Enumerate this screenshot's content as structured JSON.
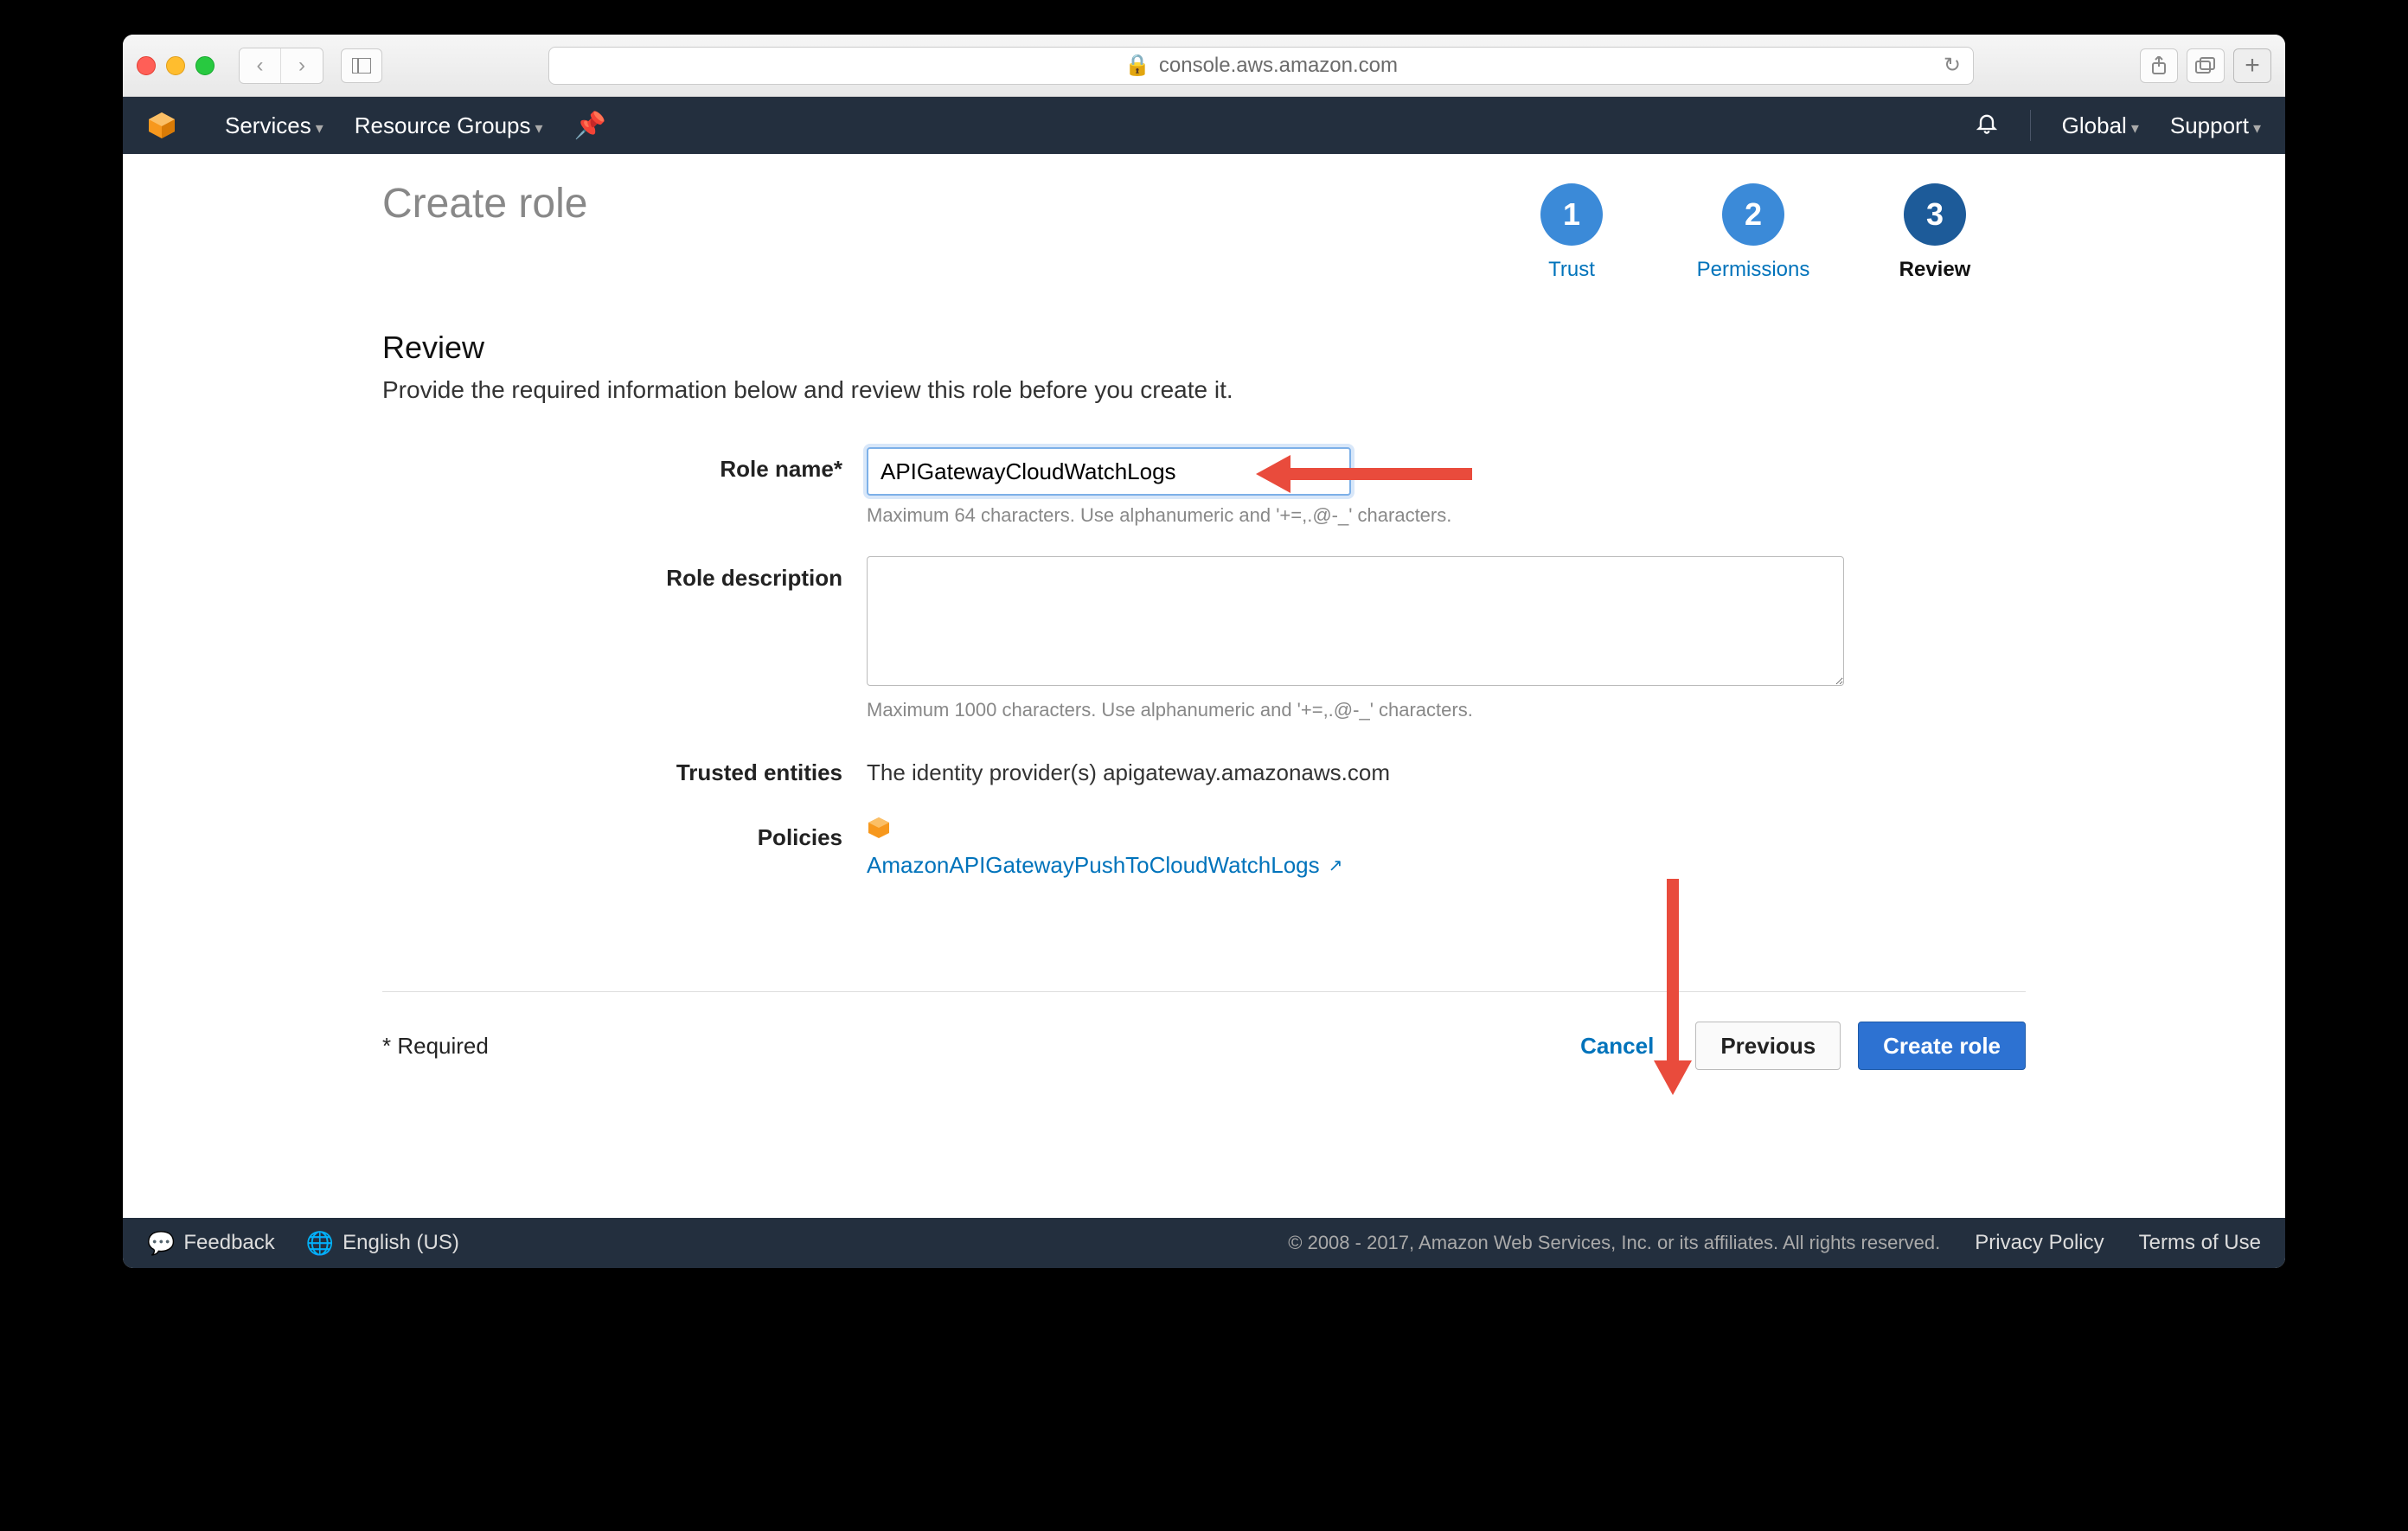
{
  "browser": {
    "url_host": "console.aws.amazon.com",
    "lock": "🔒"
  },
  "nav": {
    "services": "Services",
    "resource_groups": "Resource Groups",
    "global": "Global",
    "support": "Support"
  },
  "title": "Create role",
  "steps": [
    {
      "num": "1",
      "label": "Trust"
    },
    {
      "num": "2",
      "label": "Permissions"
    },
    {
      "num": "3",
      "label": "Review"
    }
  ],
  "section": {
    "heading": "Review",
    "desc": "Provide the required information below and review this role before you create it."
  },
  "form": {
    "role_name_label": "Role name*",
    "role_name_value": "APIGatewayCloudWatchLogs",
    "role_name_hint": "Maximum 64 characters. Use alphanumeric and '+=,.@-_' characters.",
    "role_desc_label": "Role description",
    "role_desc_value": "",
    "role_desc_hint": "Maximum 1000 characters. Use alphanumeric and '+=,.@-_' characters.",
    "trusted_label": "Trusted entities",
    "trusted_value": "The identity provider(s) apigateway.amazonaws.com",
    "policies_label": "Policies",
    "policy_link": "AmazonAPIGatewayPushToCloudWatchLogs"
  },
  "footer": {
    "required": "* Required",
    "cancel": "Cancel",
    "previous": "Previous",
    "create": "Create role"
  },
  "aws_footer": {
    "feedback": "Feedback",
    "language": "English (US)",
    "copyright": "© 2008 - 2017, Amazon Web Services, Inc. or its affiliates. All rights reserved.",
    "privacy": "Privacy Policy",
    "terms": "Terms of Use"
  }
}
